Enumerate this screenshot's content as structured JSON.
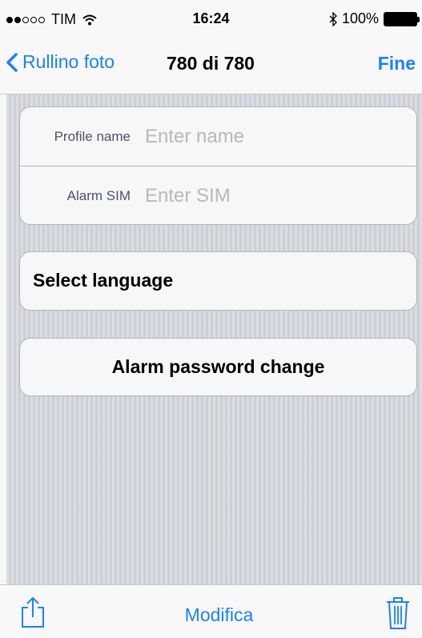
{
  "status_bar": {
    "carrier": "TIM",
    "signal_strength": 2,
    "signal_max": 5,
    "time": "16:24",
    "battery": "100%",
    "icons": [
      "signal-dots-icon",
      "wifi-icon",
      "bluetooth-icon",
      "battery-icon"
    ]
  },
  "nav": {
    "back_label": "Rullino foto",
    "title": "780 di 780",
    "done_label": "Fine",
    "accent": "#1a82fb"
  },
  "form": {
    "profile_label": "Profile name",
    "profile_placeholder": "Enter name",
    "profile_value": "",
    "sim_label": "Alarm SIM",
    "sim_placeholder": "Enter SIM",
    "sim_value": ""
  },
  "actions": {
    "select_language": "Select language",
    "password_change": "Alarm password change"
  },
  "toolbar": {
    "edit_label": "Modifica",
    "icons": [
      "share-icon",
      "trash-icon"
    ]
  }
}
